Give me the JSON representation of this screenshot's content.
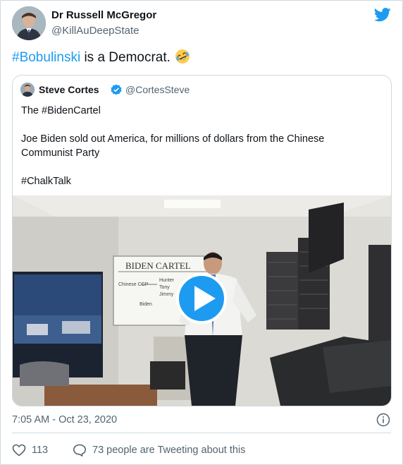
{
  "author": {
    "display_name": "Dr Russell McGregor",
    "handle": "@KillAuDeepState"
  },
  "tweet": {
    "hashtag": "#Bobulinski",
    "text": " is a Democrat.",
    "emoji": "rolling-on-floor-laughing"
  },
  "quoted": {
    "display_name": "Steve Cortes",
    "handle": "@CortesSteve",
    "line1": "The #BidenCartel",
    "line2": "Joe Biden sold out America, for millions of dollars from the Chinese",
    "line3": "Communist Party",
    "line4": "#ChalkTalk",
    "whiteboard_title": "BIDEN CARTEL",
    "whiteboard_notes": [
      "Chinese CCP",
      "Hunter",
      "Tony",
      "Jimmy",
      "Biden"
    ]
  },
  "meta": {
    "timestamp": "7:05 AM - Oct 23, 2020",
    "likes": "113",
    "tweeting": "73 people are Tweeting about this"
  },
  "colors": {
    "brand": "#1d9bf0",
    "text": "#0f1419",
    "muted": "#536471",
    "border": "#cfd9de"
  }
}
